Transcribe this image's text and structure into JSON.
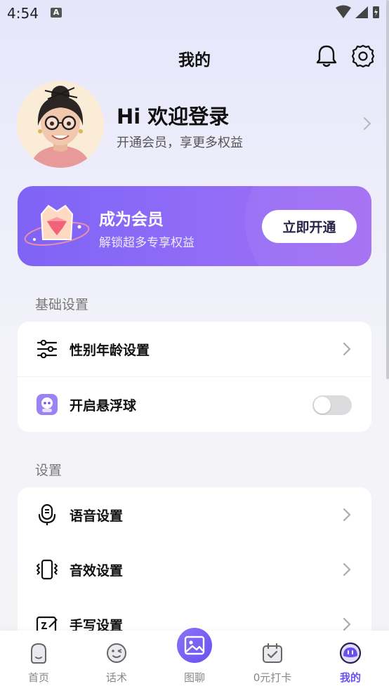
{
  "status": {
    "time": "4:54",
    "notification_badge": "A"
  },
  "header": {
    "title": "我的",
    "bell_icon": "bell-icon",
    "settings_icon": "gear-icon"
  },
  "profile": {
    "greeting": "Hi 欢迎登录",
    "subtitle": "开通会员，享更多权益"
  },
  "vip": {
    "title": "成为会员",
    "description": "解锁超多专享权益",
    "button": "立即开通",
    "gradient_start": "#7f63f6",
    "gradient_end": "#a36df2"
  },
  "basic_settings": {
    "title": "基础设置",
    "items": [
      {
        "label": "性别年龄设置",
        "icon": "sliders-icon",
        "control": "chevron"
      },
      {
        "label": "开启悬浮球",
        "icon": "robot-icon",
        "control": "toggle",
        "toggle_on": false
      }
    ]
  },
  "settings": {
    "title": "设置",
    "items": [
      {
        "label": "语音设置",
        "icon": "microphone-icon",
        "control": "chevron"
      },
      {
        "label": "音效设置",
        "icon": "vibrate-icon",
        "control": "chevron"
      },
      {
        "label": "手写设置",
        "icon": "handwriting-icon",
        "control": "chevron"
      }
    ]
  },
  "tabbar": {
    "tabs": [
      {
        "label": "首页",
        "icon": "home-icon",
        "active": false
      },
      {
        "label": "话术",
        "icon": "wink-icon",
        "active": false
      },
      {
        "label": "图聊",
        "icon": "image-icon",
        "active": false
      },
      {
        "label": "0元打卡",
        "icon": "calendar-check-icon",
        "active": false
      },
      {
        "label": "我的",
        "icon": "profile-face-icon",
        "active": true
      }
    ],
    "accent": "#6b4ff1"
  }
}
